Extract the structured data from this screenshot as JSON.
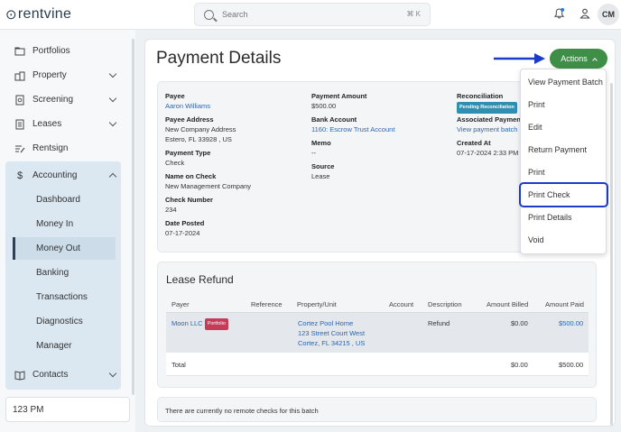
{
  "app": {
    "logo_text": "rentvine"
  },
  "search": {
    "placeholder": "Search",
    "shortcut": "⌘ K"
  },
  "user": {
    "initials": "CM"
  },
  "colors": {
    "accent_green": "#3e8e47",
    "link_blue": "#2a66b6",
    "highlight_blue": "#1a3cc8",
    "pending_badge": "#2e8fae",
    "portfolio_badge": "#c63a5a"
  },
  "sidebar": {
    "items": [
      {
        "label": "Portfolios",
        "icon": "folder-icon"
      },
      {
        "label": "Property",
        "icon": "building-icon"
      },
      {
        "label": "Screening",
        "icon": "screening-icon"
      },
      {
        "label": "Leases",
        "icon": "lease-icon"
      },
      {
        "label": "Rentsign",
        "icon": "sign-icon"
      },
      {
        "label": "Accounting",
        "icon": "dollar-icon"
      },
      {
        "label": "Contacts",
        "icon": "book-icon"
      }
    ],
    "accounting_sub": [
      "Dashboard",
      "Money In",
      "Money Out",
      "Banking",
      "Transactions",
      "Diagnostics",
      "Manager"
    ],
    "active_sub": "Money Out",
    "time_value": "123 PM"
  },
  "page": {
    "title": "Payment Details",
    "actions_label": "Actions"
  },
  "details": {
    "payee_label": "Payee",
    "payee_value": "Aaron Williams",
    "payee_address_label": "Payee Address",
    "payee_address_line1": "New Company Address",
    "payee_address_line2": "Estero, FL 33928 , US",
    "payment_type_label": "Payment Type",
    "payment_type_value": "Check",
    "name_on_check_label": "Name on Check",
    "name_on_check_value": "New Management Company",
    "check_number_label": "Check Number",
    "check_number_value": "234",
    "date_posted_label": "Date Posted",
    "date_posted_value": "07-17-2024",
    "payment_amount_label": "Payment Amount",
    "payment_amount_value": "$500.00",
    "bank_account_label": "Bank Account",
    "bank_account_value": "1160: Escrow Trust Account",
    "memo_label": "Memo",
    "memo_value": "--",
    "source_label": "Source",
    "source_value": "Lease",
    "reconciliation_label": "Reconciliation",
    "reconciliation_badge": "Pending Reconciliation",
    "associated_label": "Associated Paymen",
    "associated_value": "View payment batch",
    "created_label": "Created At",
    "created_value": "07-17-2024 2:33 PM"
  },
  "refund": {
    "title": "Lease Refund",
    "headers": [
      "Payer",
      "Reference",
      "Property/Unit",
      "Account",
      "Description",
      "Amount Billed",
      "Amount Paid"
    ],
    "row": {
      "payer": "Moon LLC",
      "payer_badge": "Portfolio",
      "property_line1": "Cortez Pool Home",
      "property_line2": "123 Street Court West",
      "property_line3": "Cortez, FL 34215 , US",
      "description": "Refund",
      "billed": "$0.00",
      "paid": "$500.00"
    },
    "total": {
      "label": "Total",
      "billed": "$0.00",
      "paid": "$500.00"
    }
  },
  "remote_checks": {
    "text": "There are currently no remote checks for this batch"
  },
  "actions_menu": {
    "items": [
      "View Payment Batch",
      "Print",
      "Edit",
      "Return Payment",
      "Print",
      "Print Check",
      "Print Details",
      "Void"
    ],
    "highlighted": "Print Check"
  }
}
